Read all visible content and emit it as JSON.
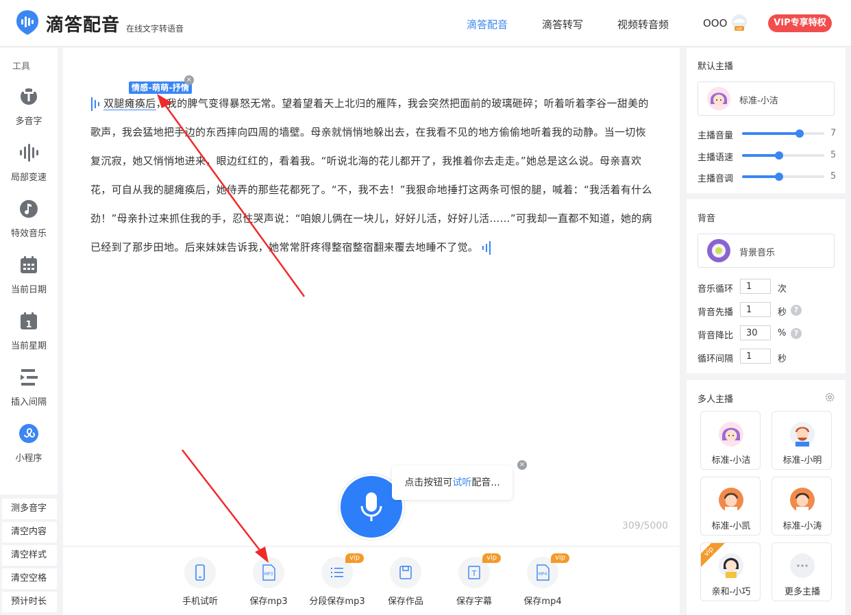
{
  "header": {
    "title": "滴答配音",
    "subtitle": "在线文字转语音",
    "nav": [
      "滴答配音",
      "滴答转写",
      "视频转音频"
    ],
    "user_name": "OOO",
    "vip_button": "VIP专享特权",
    "accent_color": "#3a86f3",
    "vip_color": "#f24d4d"
  },
  "sidebar": {
    "heading": "工具",
    "tools": [
      "多音字",
      "局部变速",
      "特效音乐",
      "当前日期",
      "当前星期",
      "插入间隔",
      "小程序"
    ],
    "buttons": [
      "测多音字",
      "清空内容",
      "清空样式",
      "清空空格",
      "预计时长"
    ]
  },
  "editor": {
    "tag_label": "情感-萌萌-抒情",
    "tag_close": "×",
    "highlight_text": "双腿瘫痪后",
    "body_text": "，我的脾气变得暴怒无常。望着望着天上北归的雁阵，我会突然把面前的玻璃砸碎；听着听着李谷一甜美的歌声，我会猛地把手边的东西摔向四周的墙壁。母亲就悄悄地躲出去，在我看不见的地方偷偷地听着我的动静。当一切恢复沉寂，她又悄悄地进来，眼边红红的，看着我。“听说北海的花儿都开了，我推着你去走走。”她总是这么说。母亲喜欢花，可自从我的腿瘫痪后，她侍弄的那些花都死了。“不，我不去！”我狠命地捶打这两条可恨的腿，喊着：“我活着有什么劲！”母亲扑过来抓住我的手，忍住哭声说：“咱娘儿俩在一块儿，好好儿活，好好儿活……”可我却一直都不知道，她的病已经到了那步田地。后来妹妹告诉我，她常常肝疼得整宿整宿翻来覆去地睡不了觉。",
    "counter": "309/5000",
    "tip_prefix": "点击按钮可",
    "tip_link": "试听",
    "tip_suffix": "配音...",
    "tip_close": "×"
  },
  "toolbar": {
    "actions": [
      {
        "label": "手机试听",
        "vip": ""
      },
      {
        "label": "保存mp3",
        "vip": "",
        "icon_text": "MP3"
      },
      {
        "label": "分段保存mp3",
        "vip": "vip"
      },
      {
        "label": "保存作品",
        "vip": ""
      },
      {
        "label": "保存字幕",
        "vip": "vip",
        "icon_text": "T"
      },
      {
        "label": "保存mp4",
        "vip": "vip",
        "icon_text": "MP4"
      }
    ]
  },
  "default_anchor": {
    "title": "默认主播",
    "name": "标准-小洁",
    "sliders": [
      {
        "label": "主播音量",
        "value": "7",
        "fraction": 0.7
      },
      {
        "label": "主播语速",
        "value": "5",
        "fraction": 0.45
      },
      {
        "label": "主播音调",
        "value": "5",
        "fraction": 0.45
      }
    ]
  },
  "bgm": {
    "title": "背音",
    "name": "背景音乐",
    "fields": [
      {
        "label": "音乐循环",
        "value": "1",
        "unit": "次",
        "help": ""
      },
      {
        "label": "背音先播",
        "value": "1",
        "unit": "秒",
        "help": "?"
      },
      {
        "label": "背音降比",
        "value": "30",
        "unit": "%",
        "help": "?"
      },
      {
        "label": "循环间隔",
        "value": "1",
        "unit": "秒",
        "help": ""
      }
    ]
  },
  "multi_anchor": {
    "title": "多人主播",
    "anchors": [
      {
        "name": "标准-小洁",
        "ribbon": ""
      },
      {
        "name": "标准-小明",
        "ribbon": ""
      },
      {
        "name": "标准-小凯",
        "ribbon": ""
      },
      {
        "name": "标准-小涛",
        "ribbon": ""
      },
      {
        "name": "亲和-小巧",
        "ribbon": "vip"
      },
      {
        "name": "更多主播",
        "ribbon": ""
      }
    ]
  }
}
